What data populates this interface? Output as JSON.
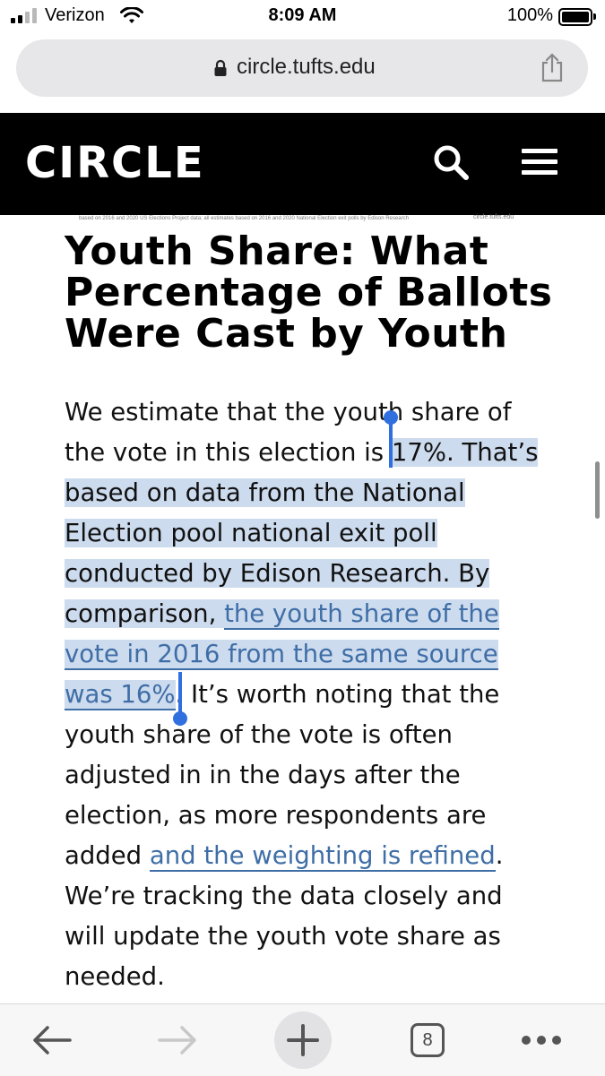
{
  "status_bar": {
    "carrier": "Verizon",
    "time": "8:09 AM",
    "battery_percent": "100%",
    "signal_bars": 2
  },
  "browser": {
    "url": "circle.tufts.edu",
    "tab_count": "8"
  },
  "site": {
    "logo_text": "CIRCLE",
    "brand_colors": {
      "header_bg": "#000000",
      "logo_red": "#c8202f",
      "logo_blue": "#2a4ea0"
    }
  },
  "figure": {
    "caption": "based on 2016 and 2020 US Elections Project data; all estimates based on 2016 and 2020 National Election exit polls by Edison Research",
    "source": "circle.tufts.edu"
  },
  "article": {
    "heading_lines": [
      "Youth Share: What",
      "Percentage of Ballots",
      "Were Cast by Youth"
    ],
    "p1": "We estimate that the youth share of",
    "p2a": "the vote in this election is ",
    "p2b": "17%. That’s",
    "p3": "based on data from the National",
    "p4": "Election pool national exit poll",
    "p5": "conducted by Edison Research. By",
    "p6a": "comparison, ",
    "p6link": "the youth share of the",
    "p7link": "vote in 2016 from the same source",
    "p8link": "was 16%",
    "p8b": ". It’s worth noting that the",
    "p9": "youth share of the vote is often",
    "p10": "adjusted in in the days after the",
    "p11": "election, as more respondents are",
    "p12a": "added ",
    "p12link": "and the weighting is refined",
    "p12b": ".",
    "p13": "We’re tracking the data closely and",
    "p14": "will update the youth vote share as",
    "p15": "needed."
  },
  "icons": {
    "lock": "lock-icon",
    "share": "share-icon",
    "search": "search-icon",
    "menu": "hamburger-menu-icon",
    "back": "back-arrow-icon",
    "forward": "forward-arrow-icon",
    "new_tab": "plus-icon",
    "tabs": "tabs-icon",
    "more": "more-icon"
  },
  "selection_color": "#cddbee",
  "link_color": "#3f6ea6"
}
